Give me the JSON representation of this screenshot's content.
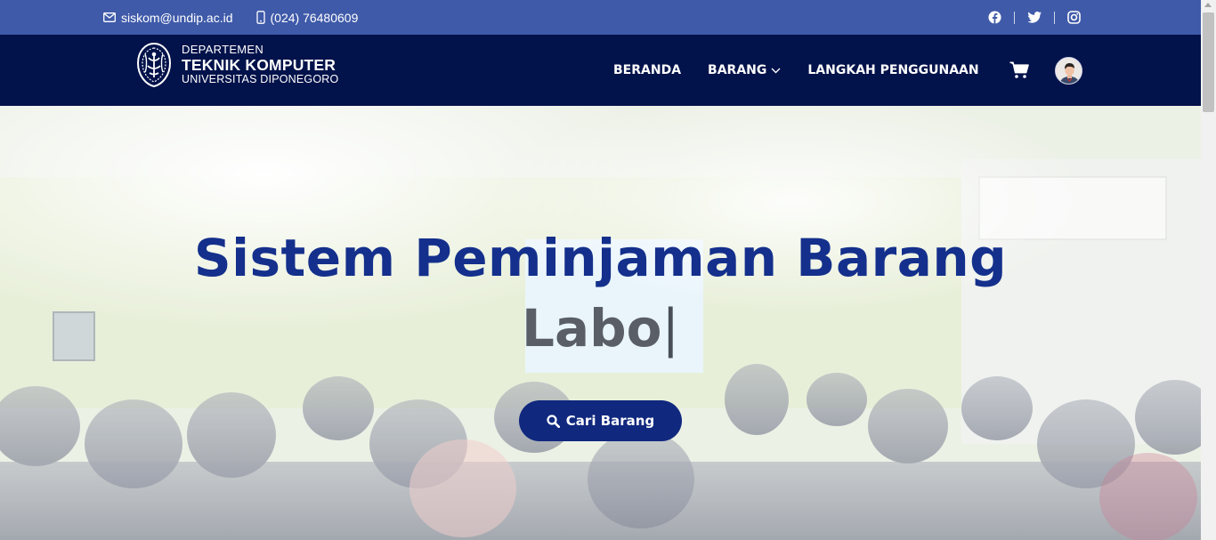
{
  "topbar": {
    "email": "siskom@undip.ac.id",
    "phone": "(024) 76480609",
    "social": [
      "facebook-icon",
      "twitter-icon",
      "instagram-icon"
    ]
  },
  "brand": {
    "line1": "DEPARTEMEN",
    "line2": "TEKNIK KOMPUTER",
    "line3": "UNIVERSITAS DIPONEGORO"
  },
  "nav": {
    "items": [
      {
        "label": "BERANDA"
      },
      {
        "label": "BARANG",
        "has_dropdown": true
      },
      {
        "label": "LANGKAH PENGGUNAAN"
      }
    ],
    "cart_icon": "cart-icon",
    "avatar_icon": "user-avatar"
  },
  "hero": {
    "title": "Sistem Peminjaman Barang",
    "typed_text": "Labo",
    "caret": "|",
    "cta_label": "Cari Barang",
    "cta_icon": "search-icon"
  },
  "colors": {
    "topbar_bg": "#3f5aa9",
    "navbar_bg": "#02124a",
    "title": "#14308c",
    "typed": "#5a5e66",
    "cta_bg": "#10287e"
  }
}
